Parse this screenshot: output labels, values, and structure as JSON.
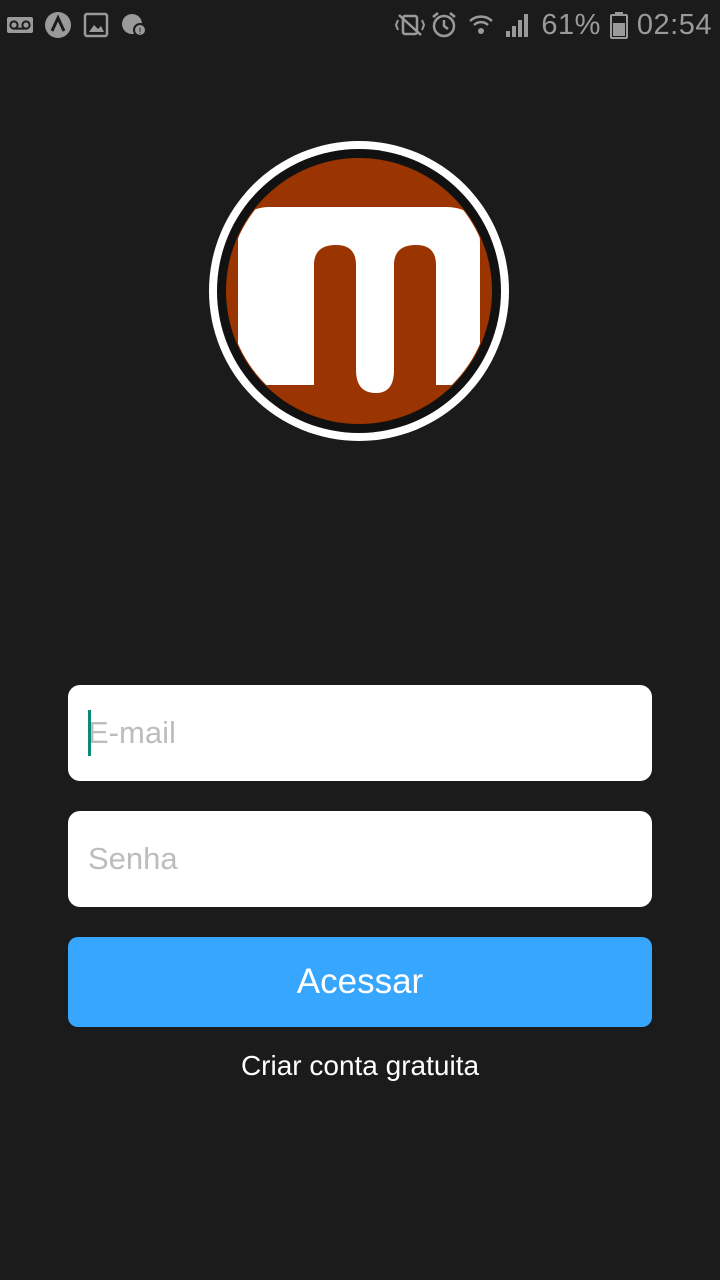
{
  "status_bar": {
    "left_icons": [
      "voicemail-icon",
      "navigation-app-icon",
      "image-icon",
      "notification-badge-icon"
    ],
    "right_icons": [
      "mute-vibrate-icon",
      "alarm-icon",
      "wifi-icon",
      "signal-icon",
      "battery-icon"
    ],
    "battery_percent": "61%",
    "time": "02:54"
  },
  "logo": {
    "letter": "m",
    "ring_color": "#ffffff",
    "fill_color": "#9a3400"
  },
  "login_form": {
    "email_placeholder": "E-mail",
    "password_placeholder": "Senha",
    "submit_label": "Acessar",
    "create_account_label": "Criar conta gratuita"
  },
  "colors": {
    "background": "#1b1b1b",
    "accent": "#36a6ff",
    "caret": "#0c8a78"
  }
}
